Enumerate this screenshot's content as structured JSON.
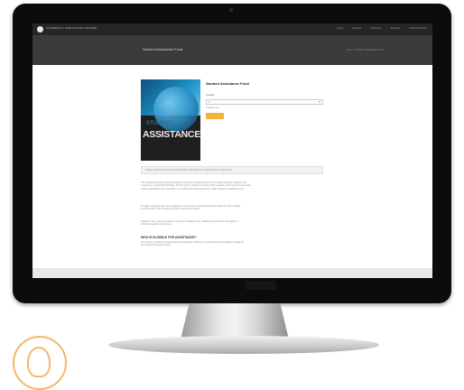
{
  "site": {
    "brand": "UNIVERSITY ASSISTANCE CENTER",
    "nav": [
      "Home",
      "Services",
      "Resources",
      "About Us",
      "Student Services"
    ]
  },
  "subheader": {
    "title": "Student Assistance Fund",
    "breadcrumb": "Home / Student Assistance Fund"
  },
  "cover": {
    "word_top": "STUDENT",
    "word_main": "ASSISTANCE"
  },
  "form": {
    "title": "Student Assistance Fund",
    "field_label": "Quantity",
    "select_value": "1",
    "hint": "Available now",
    "button_label": "Add to Cart"
  },
  "notice": "Please read the information below before submitting your application for assistance.",
  "paragraphs": [
    {
      "lines": [
        "The Student Assistance Fund provides emergency financial support to currently enrolled students who",
        "experience unexpected hardship. Funds may be used for housing, food, medical costs and other essential",
        "needs. Applications are reviewed on a rolling basis and awards are made subject to available funds."
      ]
    },
    {
      "lines": [
        "To apply, complete the online application and provide supporting documentation for your request.",
        "A staff member will contact you within five business days."
      ]
    },
    {
      "lines": [
        "Students may receive assistance once per academic year. Additional restrictions may apply to",
        "certain categories of expense."
      ]
    }
  ],
  "section": {
    "heading": "WHO IS ELIGIBLE FOR ASSISTANCE?",
    "lines": [
      "All currently enrolled undergraduate and graduate students in good standing are eligible to apply for",
      "the Student Assistance Fund."
    ]
  }
}
